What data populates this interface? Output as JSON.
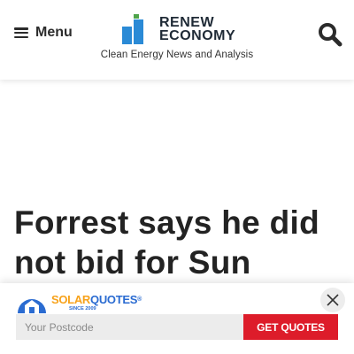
{
  "header": {
    "menu_label": "Menu",
    "logo_line1": "RENEW",
    "logo_line2": "ECONOMY",
    "tagline": "Clean Energy News and Analysis"
  },
  "article": {
    "headline": "Forrest says he did not bid for Sun Cable,"
  },
  "promo": {
    "brand_part1": "SOLAR",
    "brand_part2": "QUOTES",
    "brand_mark": "®",
    "since": "SINCE 2009",
    "postcode_placeholder": "Your Postcode",
    "button_label": "GET QUOTES"
  },
  "colors": {
    "logo_blue": "#2a8ad6",
    "logo_green": "#4fa44b",
    "promo_button": "#dd1c2a",
    "solarquotes_blue": "#2a6bd1",
    "solarquotes_orange": "#f7a21b"
  },
  "icons": {
    "menu": "hamburger-icon",
    "search": "search-icon",
    "close": "close-icon"
  }
}
